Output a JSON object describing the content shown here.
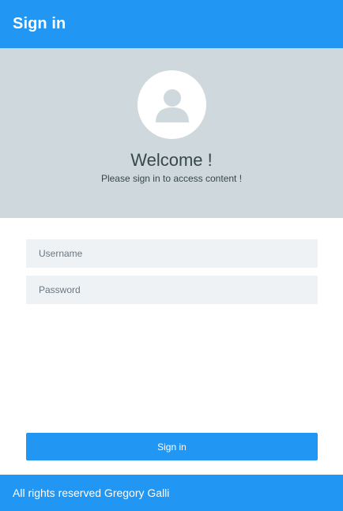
{
  "header": {
    "title": "Sign in"
  },
  "hero": {
    "avatar_icon": "user-icon",
    "welcome": "Welcome !",
    "subtitle": "Please sign in to access content !"
  },
  "form": {
    "username": {
      "value": "",
      "placeholder": "Username"
    },
    "password": {
      "value": "",
      "placeholder": "Password"
    },
    "submit_label": "Sign in"
  },
  "footer": {
    "text": "All rights reserved Gregory Galli"
  },
  "colors": {
    "primary": "#2196f3",
    "hero_background": "#cfd8dc",
    "input_background": "#eef2f5"
  }
}
